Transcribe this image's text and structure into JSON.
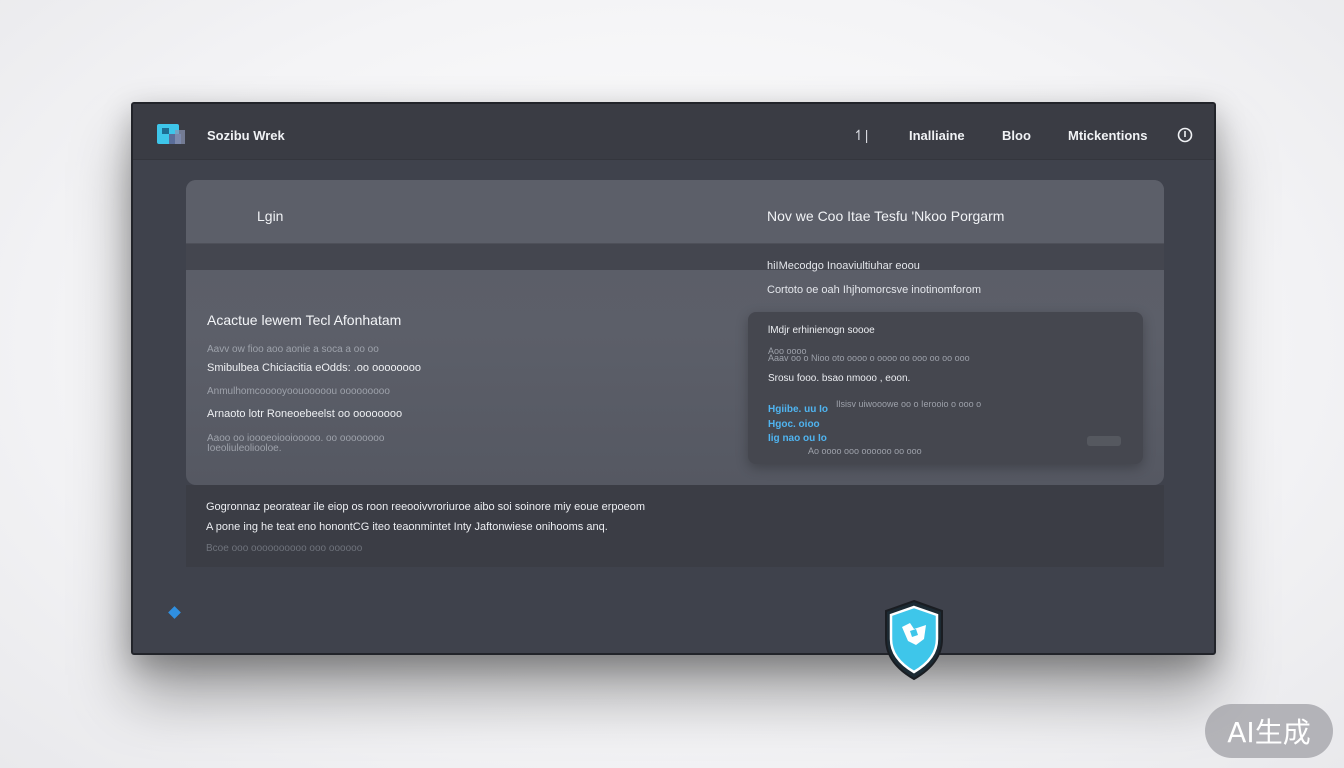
{
  "header": {
    "brand_name": "Sozibu Wrek",
    "nav_glyph": "↿|",
    "nav_items": [
      "Inalliaine",
      "Bloo",
      "Mtickentions"
    ]
  },
  "panel": {
    "login_tab": "Lgin",
    "right_title": "Nov we Coo Itae Tesfu 'Nkoo Porgarm",
    "right_sub_1": "hiIMecodgo  Inoaviultiuhar eoou",
    "right_sub_2": "Cortoto oe oah  Ihjhomorcsve inotinomforom",
    "left_heading": "Acactue lewem Tecl Afonhatam",
    "left_lines": [
      "Aavv ow fioo aoo aonie a soca a oo oo",
      "Smibulbea  Chiciacitia eOdds: .oo oooooooo",
      "Anmulhomcooooyoouooooou ooooooooo",
      "Arnaoto  lotr  Roneoebeelst  oo oooooooo",
      "Aaoo oo  ioooeoiooiooooo. oo oooooooo",
      "Ioeoliuleoliooloe."
    ],
    "card": {
      "title": "lMdjr erhinienogn  soooe",
      "faint_1": "Aoo oooo",
      "faint_2": "Aaav oo o Nioo oto oooo o oooo oo ooo  oo oo ooo",
      "line_1": "Srosu fooo. bsao nmooo , eoon.",
      "link_1": "Hgiibe. uu Io",
      "link_2": "Hgoc. oioo",
      "link_3": "Iig nao ou Io",
      "side_text": "Ilsisv uiwooowe oo o Ierooio  o ooo o",
      "bottom_faint": "Ao oooo ooo oooooo  oo ooo"
    }
  },
  "bottom": {
    "line_1": "Gogronnaz peoratear ile eiop os roon reeooivvroriuroe aibo soi soinore miy eoue erpoeom",
    "line_2": "A pone ing he teat eno honontCG iteo teaonmintet  Inty Jaftonwiese onihooms anq.",
    "line_3": "Bcoe ooo oooooooooo ooo oooooo"
  },
  "badge": {
    "label": "AI生成"
  },
  "colors": {
    "window_bg": "#3f424c",
    "panel_bg": "#5a5d67",
    "accent_blue": "#2f8fe0",
    "link_blue": "#4fb4f0",
    "shield_cyan": "#3ec6ea"
  }
}
